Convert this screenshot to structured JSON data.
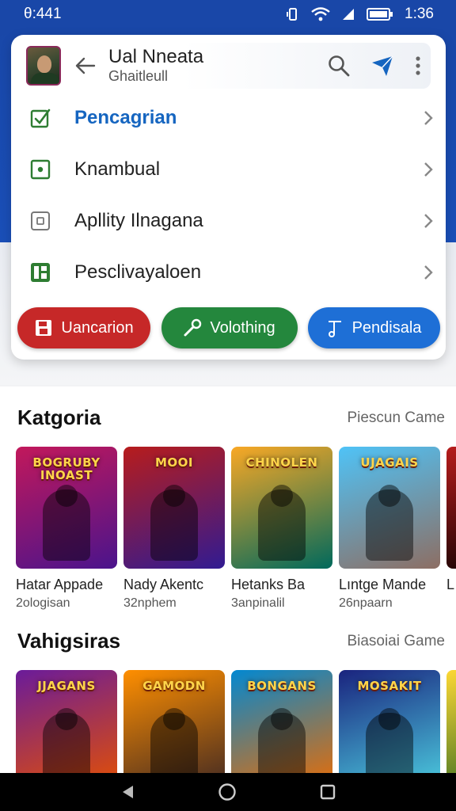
{
  "status_bar": {
    "time": "θ:441",
    "battery": "1:36"
  },
  "header": {
    "title": "Ual Nneata",
    "subtitle": "Ghaitleull"
  },
  "menu": [
    {
      "label": "Pencagrian",
      "icon": "checkbox-icon",
      "active": true
    },
    {
      "label": "Knambual",
      "icon": "square-dot-icon",
      "active": false
    },
    {
      "label": "Apllity Ilnagana",
      "icon": "square-icon",
      "active": false
    },
    {
      "label": "Pesclivayaloen",
      "icon": "grid-icon",
      "active": false
    }
  ],
  "chips": [
    {
      "label": "Uancarion",
      "icon": "save-icon",
      "color": "#c62828"
    },
    {
      "label": "Volothing",
      "icon": "wrench-icon",
      "color": "#24873d"
    },
    {
      "label": "Pendisala",
      "icon": "music-icon",
      "color": "#1e6fd6"
    }
  ],
  "sections": [
    {
      "title": "Katgoria",
      "link": "Piescun Came",
      "games": [
        {
          "name": "Hatar Appade",
          "sub": "2ologisan",
          "logo": "BOGRUBY INOAST",
          "colors": [
            "#c2185b",
            "#4a148c"
          ]
        },
        {
          "name": "Nady Akentc",
          "sub": "32nphem",
          "logo": "MOOI",
          "colors": [
            "#b71c1c",
            "#311b92"
          ]
        },
        {
          "name": "Hetanks Ba",
          "sub": "3anpinalil",
          "logo": "CHINOLEN",
          "colors": [
            "#f9a825",
            "#00695c"
          ]
        },
        {
          "name": "Lıntge Mande",
          "sub": "26npaarn",
          "logo": "UJAGAIS",
          "colors": [
            "#4fc3f7",
            "#8d6e63"
          ]
        },
        {
          "name": "L",
          "sub": "",
          "logo": "G",
          "colors": [
            "#b71c1c",
            "#000000"
          ]
        }
      ]
    },
    {
      "title": "Vahigsiras",
      "link": "Biasoiai Game",
      "games": [
        {
          "name": "",
          "sub": "",
          "logo": "JJAGANS",
          "colors": [
            "#6a1b9a",
            "#e65100"
          ]
        },
        {
          "name": "",
          "sub": "",
          "logo": "GAMODN",
          "colors": [
            "#ff8f00",
            "#3e2723"
          ]
        },
        {
          "name": "",
          "sub": "",
          "logo": "BONGANS",
          "colors": [
            "#0288d1",
            "#ef6c00"
          ]
        },
        {
          "name": "",
          "sub": "",
          "logo": "MOSAKIT",
          "colors": [
            "#1a237e",
            "#4dd0e1"
          ]
        },
        {
          "name": "",
          "sub": "",
          "logo": "",
          "colors": [
            "#fdd835",
            "#1b5e20"
          ]
        }
      ]
    }
  ],
  "colors": {
    "primary": "#1947a8",
    "accent": "#1565c0"
  }
}
